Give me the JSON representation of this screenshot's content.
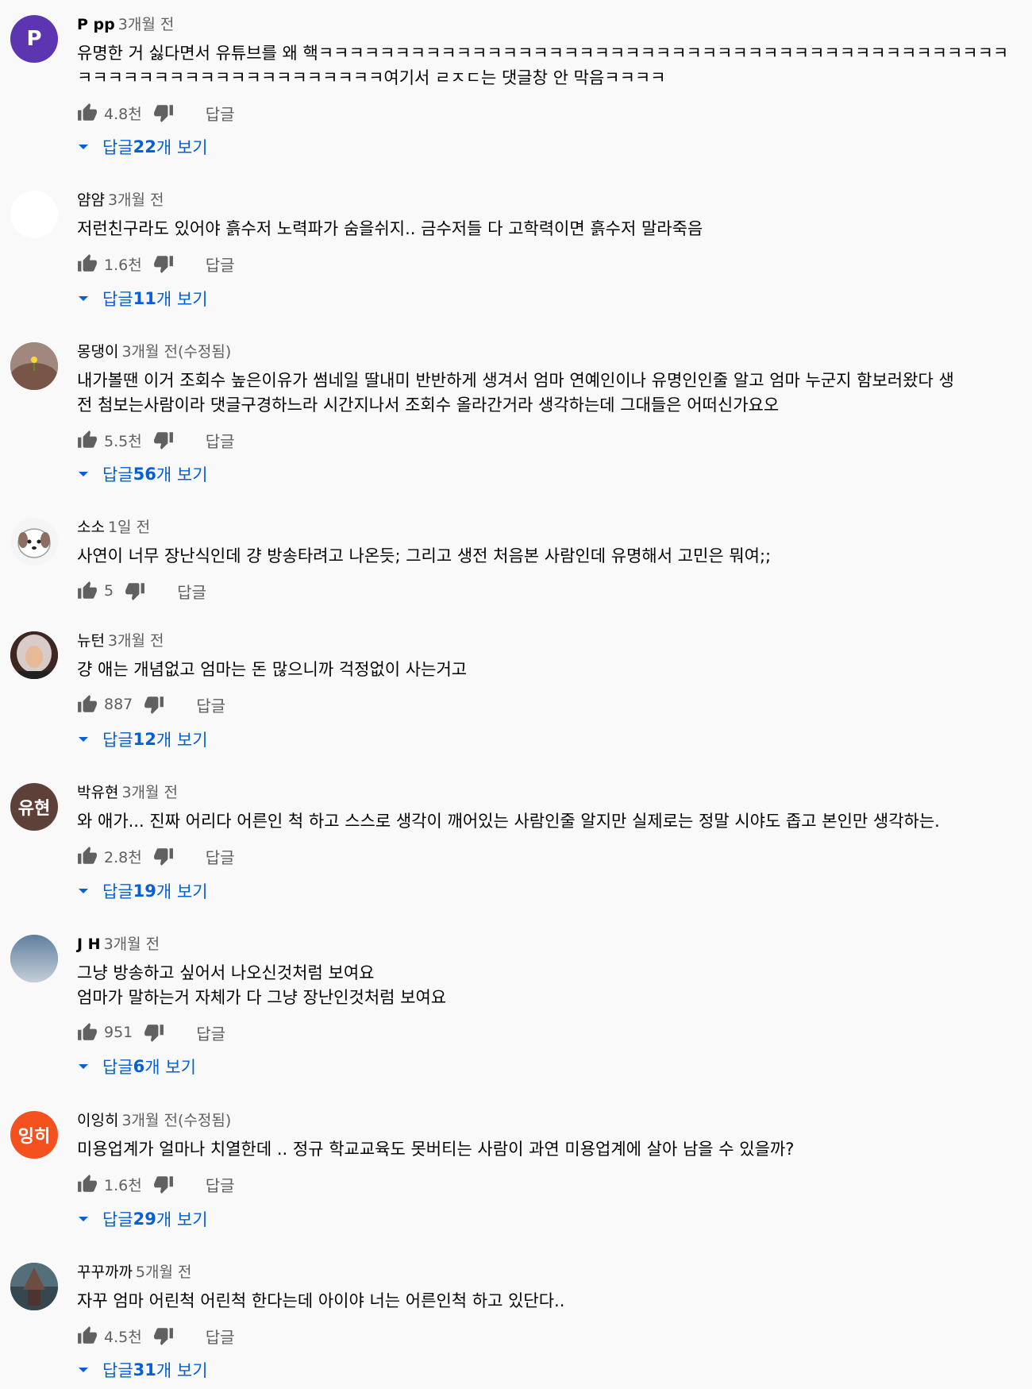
{
  "labels": {
    "reply": "답글"
  },
  "colors": {
    "accent_link": "#065fd4",
    "secondary_text": "#606060"
  },
  "comments": [
    {
      "author": "P pp",
      "time": "3개월 전",
      "avatar_letter": "P",
      "avatar_color": "#5e35b1",
      "text": "유명한 거 싫다면서 유튜브를 왜 핵ㅋㅋㅋㅋㅋㅋㅋㅋㅋㅋㅋㅋㅋㅋㅋㅋㅋㅋㅋㅋㅋㅋㅋㅋㅋㅋㅋㅋㅋㅋㅋㅋㅋㅋㅋㅋㅋㅋㅋㅋㅋㅋㅋㅋㅋ\nㅋㅋㅋㅋㅋㅋㅋㅋㅋㅋㅋㅋㅋㅋㅋㅋㅋㅋㅋㅋ여기서 ㄹㅈㄷ는 댓글창 안 막음ㅋㅋㅋㅋ",
      "likes": "4.8천",
      "replies_count": "22",
      "replies_prefix": "답글 ",
      "replies_suffix": "개 보기"
    },
    {
      "author": "얌얌",
      "time": "3개월 전",
      "avatar_letter": "",
      "avatar_color": "#ffffff",
      "text": "저런친구라도 있어야 흙수저 노력파가 숨을쉬지.. 금수저들 다 고학력이면 흙수저 말라죽음",
      "likes": "1.6천",
      "replies_count": "11",
      "replies_prefix": "답글 ",
      "replies_suffix": "개 보기"
    },
    {
      "author": "몽댕이",
      "time": "3개월 전(수정됨)",
      "avatar_letter": "",
      "avatar_color": "#8d6e63",
      "text": "내가볼땐 이거 조회수 높은이유가 썸네일 딸내미 반반하게 생겨서 엄마 연예인이나 유명인인줄 알고 엄마 누군지 함보러왔다 생\n전 첨보는사람이라 댓글구경하느라 시간지나서 조회수 올라간거라 생각하는데 그대들은 어떠신가요오",
      "likes": "5.5천",
      "replies_count": "56",
      "replies_prefix": "답글 ",
      "replies_suffix": "개 보기"
    },
    {
      "author": "소소",
      "time": "1일 전",
      "avatar_letter": "",
      "avatar_color": "#e0e0e0",
      "text": "사연이 너무 장난식인데 걍 방송타려고 나온듯; 그리고 생전 처음본 사람인데 유명해서 고민은 뭐여;;",
      "likes": "5",
      "replies_count": "",
      "replies_prefix": "",
      "replies_suffix": ""
    },
    {
      "author": "뉴턴",
      "time": "3개월 전",
      "avatar_letter": "",
      "avatar_color": "#3e2723",
      "text": "걍 애는 개념없고 엄마는 돈 많으니까 걱정없이 사는거고",
      "likes": "887",
      "replies_count": "12",
      "replies_prefix": "답글 ",
      "replies_suffix": "개 보기"
    },
    {
      "author": "박유현",
      "time": "3개월 전",
      "avatar_letter": "유현",
      "avatar_color": "#5d4037",
      "text": "와 애가... 진짜 어리다 어른인 척 하고 스스로 생각이 깨어있는 사람인줄 알지만 실제로는 정말 시야도 좁고 본인만 생각하는.",
      "likes": "2.8천",
      "replies_count": "19",
      "replies_prefix": "답글 ",
      "replies_suffix": "개 보기"
    },
    {
      "author": "J H",
      "time": "3개월 전",
      "avatar_letter": "",
      "avatar_color": "#7896b4",
      "text": "그냥 방송하고 싶어서 나오신것처럼 보여요\n엄마가 말하는거 자체가 다 그냥 장난인것처럼 보여요",
      "likes": "951",
      "replies_count": "6",
      "replies_prefix": "답글 ",
      "replies_suffix": "개 보기"
    },
    {
      "author": "이잉히",
      "time": "3개월 전(수정됨)",
      "avatar_letter": "잉히",
      "avatar_color": "#f4511e",
      "text": "미용업계가 얼마나 치열한데 .. 정규 학교교육도 못버티는 사람이 과연 미용업계에 살아 남을 수 있을까?",
      "likes": "1.6천",
      "replies_count": "29",
      "replies_prefix": "답글 ",
      "replies_suffix": "개 보기"
    },
    {
      "author": "꾸꾸까까",
      "time": "5개월 전",
      "avatar_letter": "",
      "avatar_color": "#455a64",
      "text": "자꾸 엄마 어린척 어린척 한다는데 아이야 너는 어른인척 하고 있단다..",
      "likes": "4.5천",
      "replies_count": "31",
      "replies_prefix": "답글 ",
      "replies_suffix": "개 보기"
    }
  ]
}
